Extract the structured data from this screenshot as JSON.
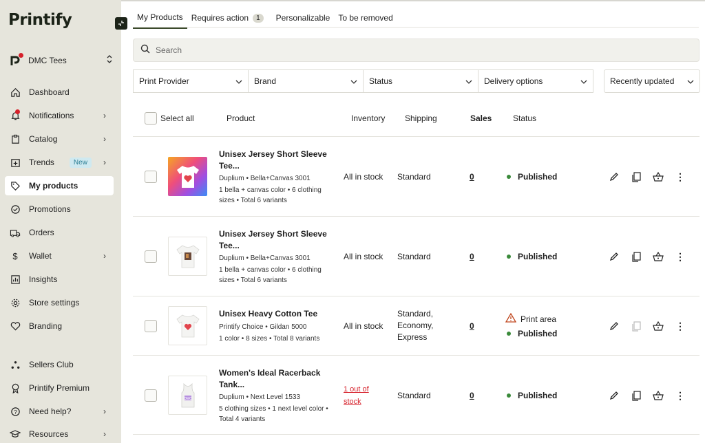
{
  "app": {
    "logo": "Printify"
  },
  "store": {
    "name": "DMC Tees"
  },
  "sidebar": {
    "items": [
      {
        "label": "Dashboard",
        "icon": "home-icon"
      },
      {
        "label": "Notifications",
        "icon": "bell-icon"
      },
      {
        "label": "Catalog",
        "icon": "clipboard-icon"
      },
      {
        "label": "Trends",
        "icon": "trends-icon",
        "badge": "New"
      },
      {
        "label": "My products",
        "icon": "tag-icon"
      },
      {
        "label": "Promotions",
        "icon": "badge-check-icon"
      },
      {
        "label": "Orders",
        "icon": "truck-icon"
      },
      {
        "label": "Wallet",
        "icon": "dollar-icon"
      },
      {
        "label": "Insights",
        "icon": "chart-icon"
      },
      {
        "label": "Store settings",
        "icon": "gear-icon"
      },
      {
        "label": "Branding",
        "icon": "heart-icon"
      },
      {
        "label": "Sellers Club",
        "icon": "community-icon"
      },
      {
        "label": "Printify Premium",
        "icon": "premium-icon"
      },
      {
        "label": "Need help?",
        "icon": "help-icon"
      },
      {
        "label": "Resources",
        "icon": "resources-icon"
      }
    ]
  },
  "tabs": [
    {
      "label": "My Products"
    },
    {
      "label": "Requires action",
      "count": "1"
    },
    {
      "label": "Personalizable"
    },
    {
      "label": "To be removed"
    }
  ],
  "search": {
    "placeholder": "Search"
  },
  "filters": [
    "Print Provider",
    "Brand",
    "Status",
    "Delivery options"
  ],
  "sort": "Recently updated",
  "table": {
    "select_all": "Select all",
    "headers": {
      "product": "Product",
      "inventory": "Inventory",
      "shipping": "Shipping",
      "sales": "Sales",
      "status": "Status"
    },
    "rows": [
      {
        "name": "Unisex Jersey Short Sleeve Tee...",
        "provider": "Duplium • Bella+Canvas 3001",
        "details": "1 bella + canvas color • 6 clothing sizes • Total 6 variants",
        "inventory": "All in stock",
        "shipping": "Standard",
        "sales": "0",
        "status": "Published"
      },
      {
        "name": "Unisex Jersey Short Sleeve Tee...",
        "provider": "Duplium • Bella+Canvas 3001",
        "details": "1 bella + canvas color • 6 clothing sizes • Total 6 variants",
        "inventory": "All in stock",
        "shipping": "Standard",
        "sales": "0",
        "status": "Published"
      },
      {
        "name": "Unisex Heavy Cotton Tee",
        "provider": "Printify Choice • Gildan 5000",
        "details": "1 color • 8 sizes • Total 8 variants",
        "inventory": "All in stock",
        "shipping": "Standard, Economy, Express",
        "sales": "0",
        "warning": "Print area",
        "status": "Published"
      },
      {
        "name": "Women's Ideal Racerback Tank...",
        "provider": "Duplium • Next Level 1533",
        "details": "5 clothing sizes • 1 next level color • Total 4 variants",
        "inventory": "1 out of stock",
        "shipping": "Standard",
        "sales": "0",
        "status": "Published"
      }
    ]
  },
  "colors": {
    "sidebar_bg": "#e6e5dc",
    "published": "#3a8a3a",
    "alert": "#d6202a",
    "warning": "#c0461d"
  }
}
